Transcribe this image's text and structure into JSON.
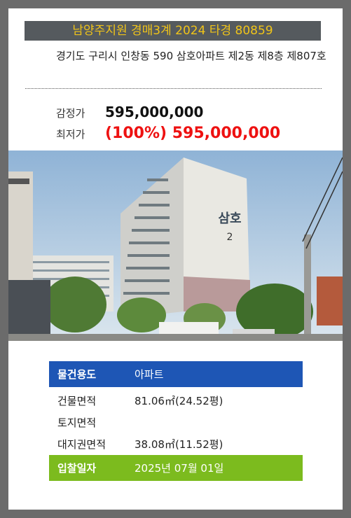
{
  "header": {
    "title": "남양주지원 경매3계 2024 타경 80859"
  },
  "address": "경기도 구리시 인창동 590 삼호아파트 제2동 제8층 제807호",
  "prices": {
    "appraisal_label": "감정가",
    "appraisal_value": "595,000,000",
    "minimum_label": "최저가",
    "minimum_value": "(100%) 595,000,000"
  },
  "photo": {
    "building_sign": "삼호",
    "building_number": "2"
  },
  "details": [
    {
      "label": "물건용도",
      "value": "아파트"
    },
    {
      "label": "건물면적",
      "value": "81.06㎡(24.52평)"
    },
    {
      "label": "토지면적",
      "value": ""
    },
    {
      "label": "대지권면적",
      "value": "38.08㎡(11.52평)"
    },
    {
      "label": "입찰일자",
      "value": "2025년 07월 01일"
    }
  ],
  "colors": {
    "title_text": "#f0c419",
    "type_row": "#1e56b5",
    "bid_row": "#7cbb1e",
    "min_price": "#ee1111"
  }
}
